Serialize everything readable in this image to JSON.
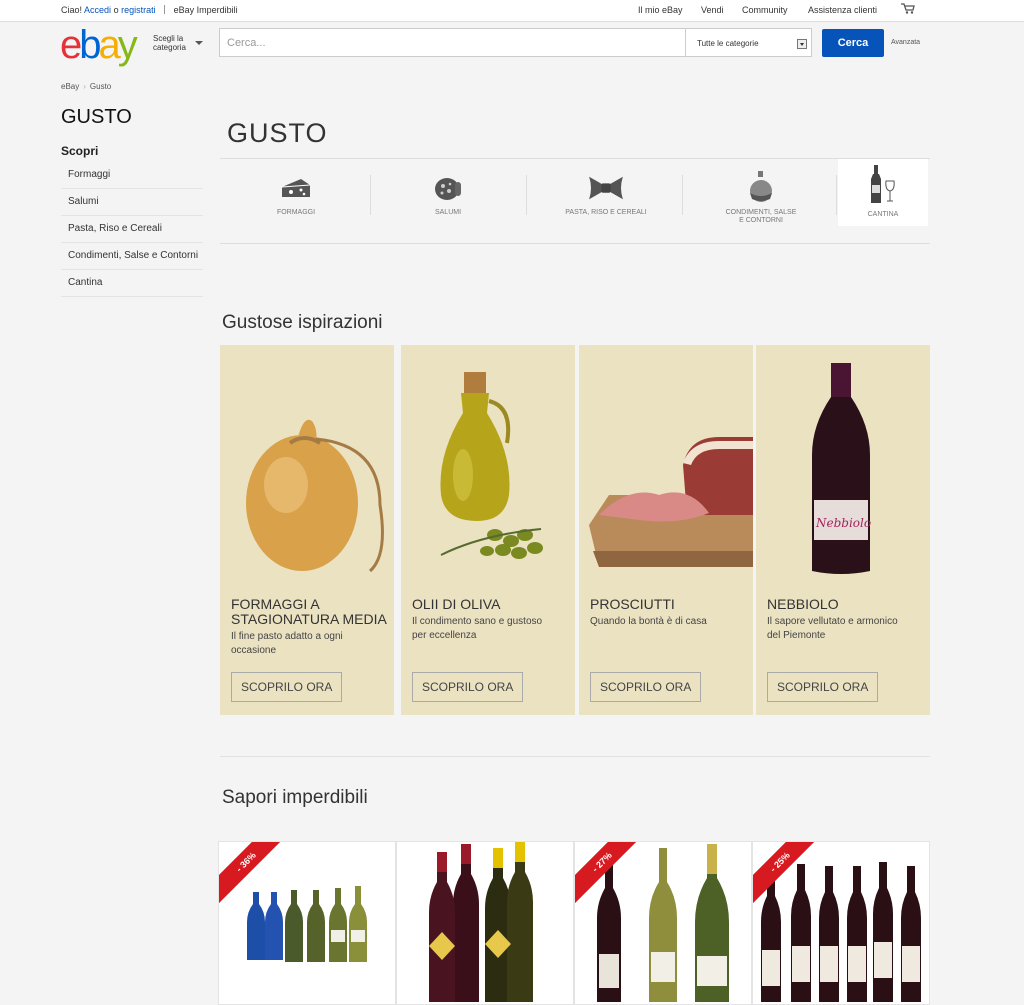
{
  "topbar": {
    "greeting": "Ciao!",
    "login": "Accedi",
    "or": "o",
    "register": "registrati",
    "deals": "eBay Imperdibili",
    "my_ebay": "Il mio eBay",
    "sell": "Vendi",
    "community": "Community",
    "support": "Assistenza clienti"
  },
  "header": {
    "logo": {
      "e": "e",
      "b": "b",
      "a": "a",
      "y": "y"
    },
    "category_picker": {
      "line1": "Scegli la",
      "line2": "categoria"
    },
    "search_placeholder": "Cerca...",
    "category_select": "Tutte le categorie",
    "search_button": "Cerca",
    "advanced": "Avanzata"
  },
  "breadcrumb": [
    "eBay",
    "Gusto"
  ],
  "sidebar": {
    "title": "GUSTO",
    "subtitle": "Scopri",
    "items": [
      "Formaggi",
      "Salumi",
      "Pasta, Riso e Cereali",
      "Condimenti, Salse e Contorni",
      "Cantina"
    ]
  },
  "main": {
    "title": "GUSTO",
    "categories": [
      {
        "label": "FORMAGGI",
        "icon": "cheese-icon"
      },
      {
        "label": "SALUMI",
        "icon": "salami-icon"
      },
      {
        "label": "PASTA, RISO E CEREALI",
        "icon": "pasta-icon"
      },
      {
        "label_1": "CONDIMENTI, SALSE",
        "label_2": "E CONTORNI",
        "icon": "oil-cruet-icon"
      },
      {
        "label": "CANTINA",
        "icon": "wine-icon",
        "active": true
      }
    ],
    "inspirations_title": "Gustose ispirazioni",
    "inspirations": [
      {
        "title_1": "FORMAGGI A",
        "title_2": "STAGIONATURA MEDIA",
        "desc_1": "Il fine pasto adatto a ogni",
        "desc_2": "occasione",
        "button": "SCOPRILO ORA"
      },
      {
        "title_1": "OLII DI OLIVA",
        "desc_1": "Il condimento sano e gustoso",
        "desc_2": "per eccellenza",
        "button": "SCOPRILO ORA"
      },
      {
        "title_1": "PROSCIUTTI",
        "desc_1": "Quando la bontà è di casa",
        "button": "SCOPRILO ORA"
      },
      {
        "title_1": "NEBBIOLO",
        "desc_1": "Il sapore vellutato e armonico",
        "desc_2": "del Piemonte",
        "button": "SCOPRILO ORA"
      }
    ],
    "deals_title": "Sapori imperdibili",
    "deals": [
      {
        "badge": "- 36%"
      },
      {
        "badge": ""
      },
      {
        "badge": "- 27%"
      },
      {
        "badge": "- 25%"
      }
    ]
  },
  "colors": {
    "ebay_red": "#e53238",
    "ebay_blue": "#0064d2",
    "ebay_yellow": "#f5af02",
    "ebay_green": "#86b817",
    "button_blue": "#0654ba",
    "card_bg": "#ebe2c2",
    "badge_red": "#d71920"
  }
}
